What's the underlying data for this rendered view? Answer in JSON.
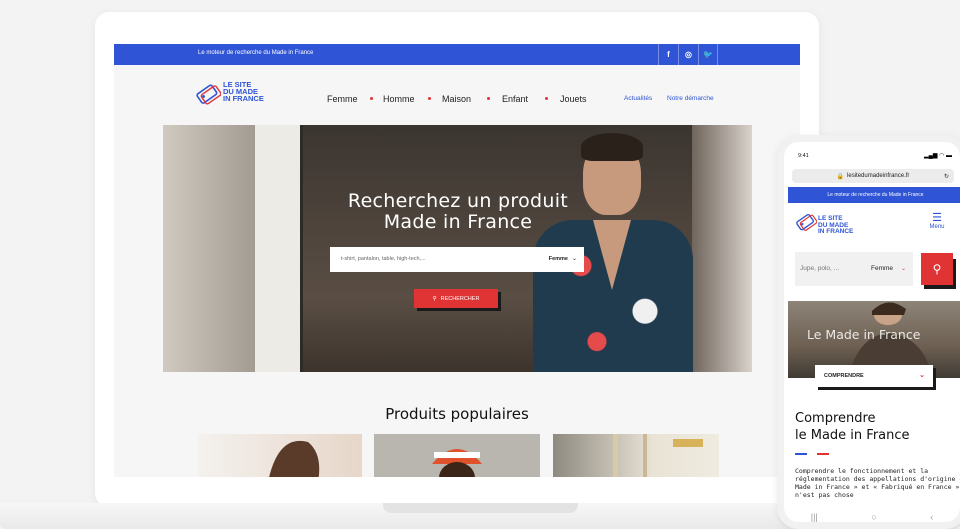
{
  "laptop": {
    "topbar": {
      "tagline": "Le moteur de recherche du Made in France",
      "social": [
        "f",
        "◎",
        "🐦"
      ]
    },
    "logo": [
      "LE SITE",
      "DU MADE",
      "IN FRANCE"
    ],
    "nav": [
      "Femme",
      "Homme",
      "Maison",
      "Enfant",
      "Jouets"
    ],
    "nav_secondary": [
      "Actualités",
      "Notre démarche"
    ],
    "hero": {
      "title_line1": "Recherchez un produit",
      "title_line2": "Made in France",
      "search_placeholder": "t-shirt, pantalon, table, high-tech,...",
      "category": "Femme",
      "button": "RECHERCHER"
    },
    "popular_title": "Produits populaires"
  },
  "phone": {
    "time": "9:41",
    "url": "lesitedumadeinfrance.fr",
    "tagline": "Le moteur de recherche du Made in France",
    "logo": [
      "LE SITE",
      "DU MADE",
      "IN FRANCE"
    ],
    "menu_label": "Menu",
    "search_placeholder": "Jupe, polo, ...",
    "category": "Femme",
    "hero_title": "Le Made in France",
    "comprendre_button": "COMPRENDRE",
    "heading_line1": "Comprendre",
    "heading_line2": "le Made in France",
    "paragraph": "Comprendre le fonctionnement et la réglementation des appellations d'origine « Made in France » et « Fabriqué en France » n'est pas chose"
  },
  "colors": {
    "brand_blue": "#2f54d6",
    "accent_red": "#e03333"
  }
}
